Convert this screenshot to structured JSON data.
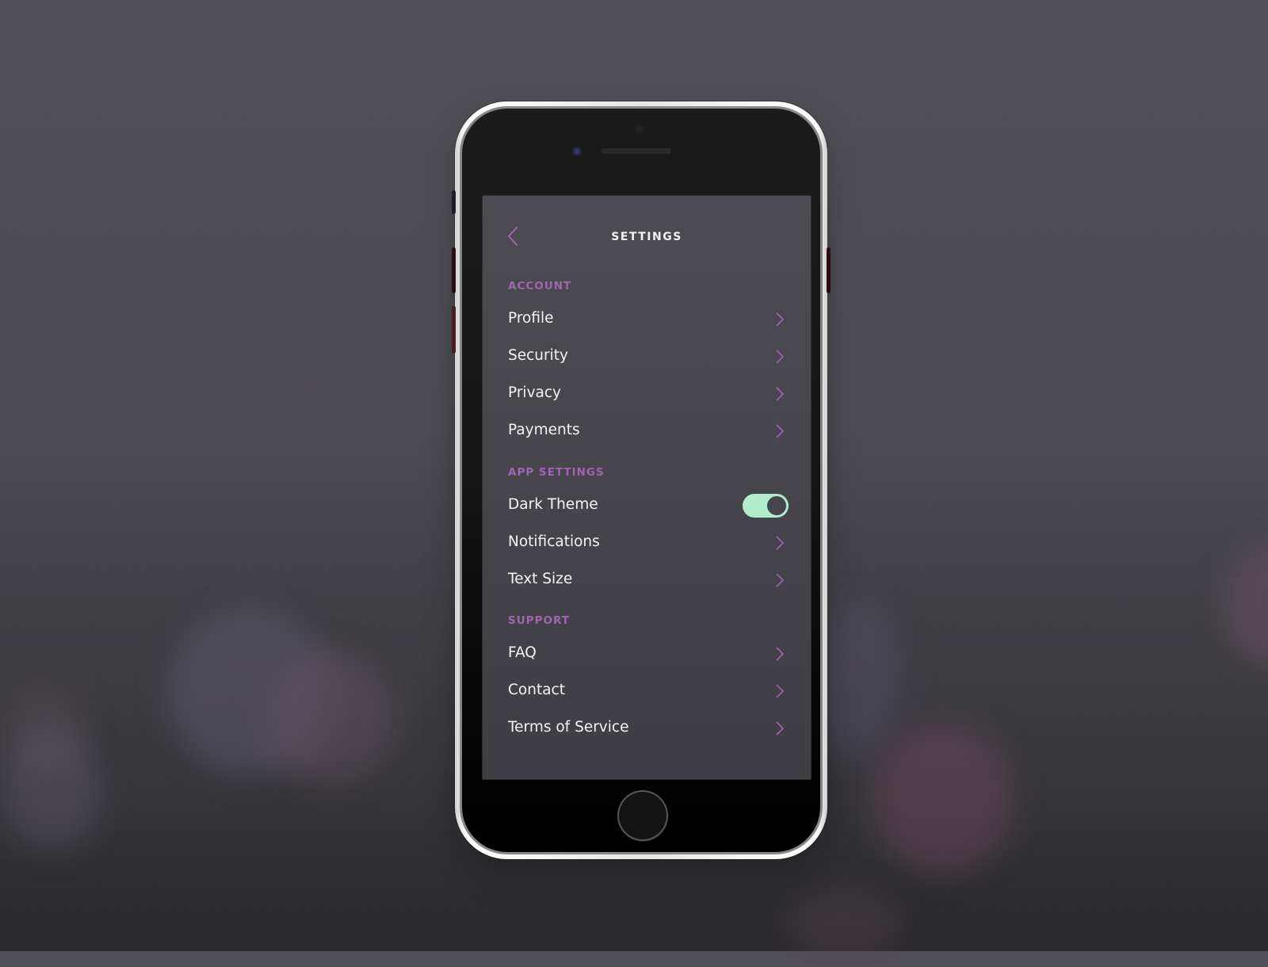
{
  "app": {
    "header": {
      "title": "SETTINGS",
      "back_icon": "chevron-left-icon"
    },
    "accent_color": "#a065b0",
    "toggle_on_color": "#b2ebcd",
    "sections": [
      {
        "label": "ACCOUNT",
        "items": [
          {
            "label": "Profile",
            "control": "chevron"
          },
          {
            "label": "Security",
            "control": "chevron"
          },
          {
            "label": "Privacy",
            "control": "chevron"
          },
          {
            "label": "Payments",
            "control": "chevron"
          }
        ]
      },
      {
        "label": "APP SETTINGS",
        "items": [
          {
            "label": "Dark Theme",
            "control": "toggle",
            "value": true
          },
          {
            "label": "Notifications",
            "control": "chevron"
          },
          {
            "label": "Text Size",
            "control": "chevron"
          }
        ]
      },
      {
        "label": "SUPPORT",
        "items": [
          {
            "label": "FAQ",
            "control": "chevron"
          },
          {
            "label": "Contact",
            "control": "chevron"
          },
          {
            "label": "Terms of Service",
            "control": "chevron"
          }
        ]
      }
    ]
  }
}
